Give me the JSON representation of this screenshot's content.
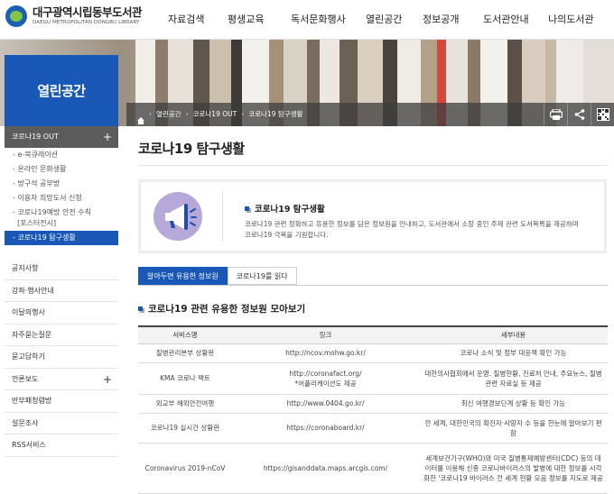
{
  "header": {
    "logo_ko": "대구광역시립동부도서관",
    "logo_en": "DAEGU METROPOLITAN DONGBU LIBRARY",
    "nav": [
      "자료검색",
      "평생교육",
      "독서문화행사",
      "열린공간",
      "정보공개",
      "도서관안내",
      "나의도서관"
    ]
  },
  "breadcrumb": [
    "열린공간",
    "코로나19 OUT",
    "코로나19 탐구생활"
  ],
  "sidebar": {
    "title": "열린공간",
    "group_label": "코로나19 OUT",
    "sub_items": [
      "e-북큐레이션",
      "온라인 문화생활",
      "방구석 공부방",
      "이용자 희망도서 신청",
      "코로나19예방 안전 수칙",
      "[포스터전시]",
      "코로나19 탐구생활"
    ],
    "menu": [
      "공지사항",
      "강좌·행사안내",
      "이달의행사",
      "자주묻는질문",
      "묻고답하기",
      "언론보도",
      "반부패청렴방",
      "설문조사",
      "RSS서비스"
    ]
  },
  "main": {
    "page_title": "코로나19 탐구생활",
    "intro_title": "코로나19 탐구생활",
    "intro_desc": "코로나19 관련 정확하고 유용한 정보를 담은 정보원을 안내하고, 도서관에서 소장 중인 주제 관련 도서목록을 제공하며 코로나19 극복을 기원합니다.",
    "tabs": [
      "알아두면 유용한 정보원",
      "코로나19를 읽다"
    ],
    "section_title": "코로나19 관련 유용한 정보원 모아보기",
    "table": {
      "headers": [
        "서비스명",
        "링크",
        "세부내용"
      ],
      "rows": [
        {
          "name": "질병관리본부 상황판",
          "link": "http://ncov.mohw.go.kr/",
          "link2": "",
          "desc": "코로나 소식 및 정부 대응책 확인 가능"
        },
        {
          "name": "KMA 코로나 팩트",
          "link": "http://coronafact.org/",
          "link2": "*어플리케이션도 제공",
          "desc": "대한의사협회에서 운영. 질병현황, 진료처 안내, 주요뉴스, 질병관련 자료실 등 제공"
        },
        {
          "name": "외교부 해외안전여행",
          "link": "http://www.0404.go.kr/",
          "link2": "",
          "desc": "최신 여행경보단계 상황 등 확인 가능"
        },
        {
          "name": "코로나19 실시간 상황판",
          "link": "https://coronaboard.kr/",
          "link2": "",
          "desc": "전 세계, 대한민국의 확진자·사망자 수 등을 한눈에 알아보기 편함"
        },
        {
          "name": "Coronavirus 2019-nCoV",
          "link": "https://gisanddata.maps.arcgis.com/",
          "link2": "",
          "desc": "세계보건기구(WHO)와 미국 질병통제예방센터(CDC) 등의 데이터를 이용해 신종 코로나바이러스의 발병에 대한 정보를 시각화한 '코로나19 바이러스 전 세계 현황 모음 정보를 지도로 제공"
        }
      ]
    }
  },
  "colors": {
    "primary": "#1958b7",
    "sidebar_head": "#5c5c5c",
    "icon_bg": "#b7a8da"
  }
}
